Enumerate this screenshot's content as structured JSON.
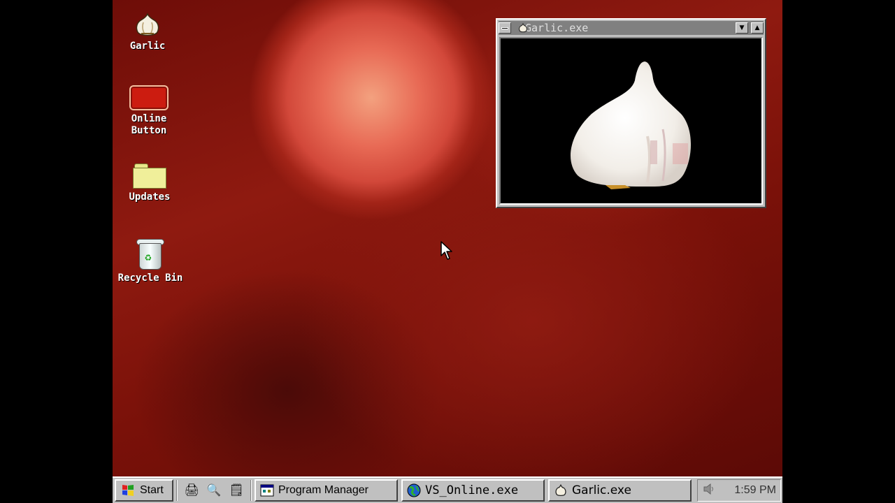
{
  "desktop": {
    "icons": [
      {
        "label": "Garlic",
        "icon": "garlic-icon"
      },
      {
        "label": "Online Button",
        "icon": "red-button-icon"
      },
      {
        "label": "Updates",
        "icon": "folder-icon"
      },
      {
        "label": "Recycle Bin",
        "icon": "recycle-bin-icon"
      }
    ]
  },
  "window": {
    "title": "Garlic.exe",
    "content_icon": "garlic-bulb-image"
  },
  "taskbar": {
    "start_label": "Start",
    "quick_launch": [
      "printer-icon",
      "explorer-icon",
      "notepad-icon"
    ],
    "tasks": [
      {
        "label": "Program Manager",
        "icon": "program-manager-icon"
      },
      {
        "label": "VS_Online.exe",
        "icon": "globe-icon"
      },
      {
        "label": "Garlic.exe",
        "icon": "garlic-icon"
      }
    ],
    "tray_icon": "speaker-icon",
    "clock": "1:59 PM"
  }
}
